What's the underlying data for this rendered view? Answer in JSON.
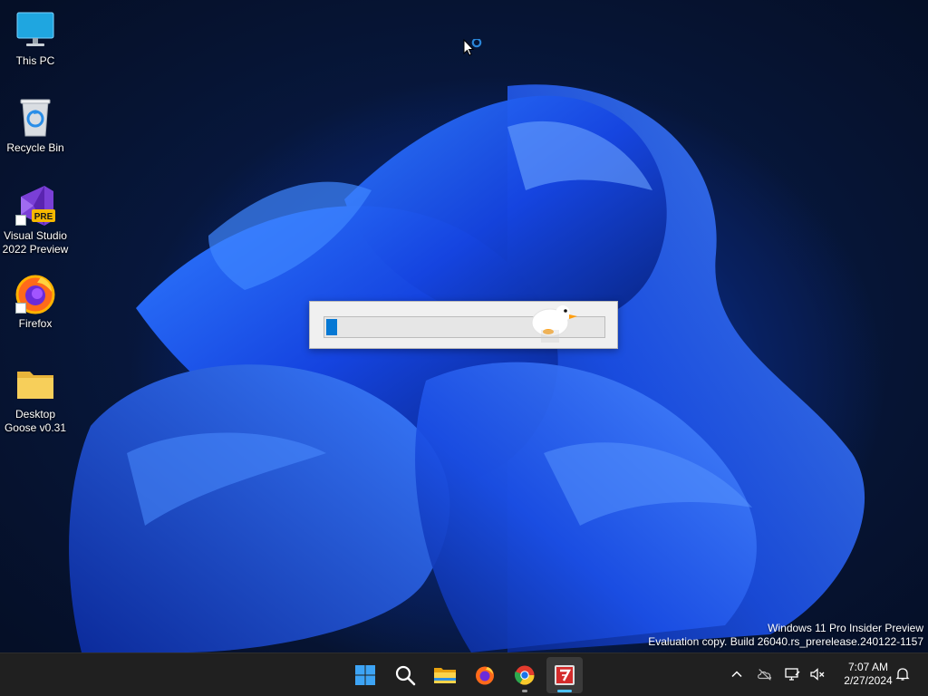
{
  "desktop_icons": [
    {
      "name": "desktop-icon-this-pc",
      "label": "This PC",
      "icon": "monitor-icon",
      "shortcut": false
    },
    {
      "name": "desktop-icon-recycle-bin",
      "label": "Recycle Bin",
      "icon": "recycle-bin-icon",
      "shortcut": false
    },
    {
      "name": "desktop-icon-visual-studio",
      "label": "Visual Studio 2022 Preview",
      "icon": "visual-studio-preview-icon",
      "badge": "PRE",
      "shortcut": true
    },
    {
      "name": "desktop-icon-firefox",
      "label": "Firefox",
      "icon": "firefox-icon",
      "shortcut": true
    },
    {
      "name": "desktop-icon-desktop-goose",
      "label": "Desktop Goose v0.31",
      "icon": "folder-icon",
      "shortcut": false
    }
  ],
  "progress_dialog": {
    "progress": 0.04,
    "fill_color": "#0678d4"
  },
  "watermark": {
    "line1": "Windows 11 Pro Insider Preview",
    "line2": "Evaluation copy. Build 26040.rs_prerelease.240122-1157"
  },
  "taskbar": {
    "apps": [
      {
        "name": "start-button",
        "icon": "windows-logo-icon",
        "running": false,
        "active": false
      },
      {
        "name": "search-button",
        "icon": "search-icon",
        "running": false,
        "active": false
      },
      {
        "name": "file-explorer-button",
        "icon": "file-explorer-icon",
        "running": false,
        "active": false
      },
      {
        "name": "firefox-taskbar-button",
        "icon": "firefox-icon",
        "running": false,
        "active": false
      },
      {
        "name": "chrome-taskbar-button",
        "icon": "chrome-icon",
        "running": true,
        "active": false
      },
      {
        "name": "app-7zip-taskbar-button",
        "icon": "7zip-icon",
        "running": true,
        "active": true
      }
    ],
    "tray": [
      "chevron-up-icon",
      "onedrive-offline-icon",
      "network-icon",
      "volume-muted-icon"
    ],
    "time": "7:07 AM",
    "date": "2/27/2024",
    "accent": "#4cc2ff"
  }
}
